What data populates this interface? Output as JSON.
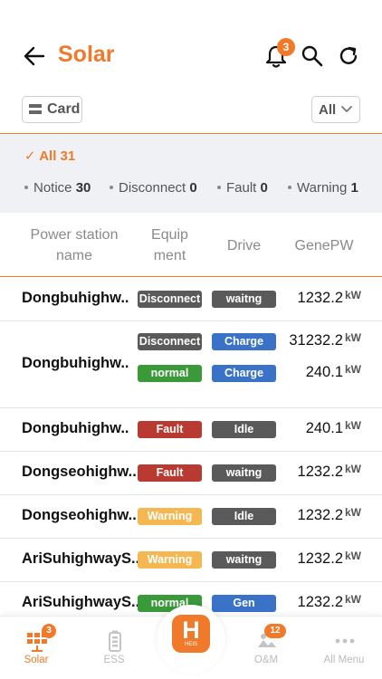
{
  "header": {
    "title": "Solar",
    "notification_count": "3"
  },
  "controls": {
    "view_label": "Card",
    "filter_label": "All"
  },
  "summary": {
    "all_label": "All",
    "all_count": "31",
    "stats": [
      {
        "label": "Notice",
        "count": "30"
      },
      {
        "label": "Disconnect",
        "count": "0"
      },
      {
        "label": "Fault",
        "count": "0"
      },
      {
        "label": "Warning",
        "count": "1"
      }
    ]
  },
  "table": {
    "columns": [
      "Power station\nname",
      "Equip\nment",
      "Drive",
      "GenePW"
    ],
    "unit": "kW",
    "rows": [
      {
        "name": "Dongbuhighw..",
        "entries": [
          {
            "equipment": "Disconnect",
            "drive": "waitng",
            "power": "1232.2"
          }
        ]
      },
      {
        "name": "Dongbuhighw..",
        "entries": [
          {
            "equipment": "Disconnect",
            "drive": "Charge",
            "power": "31232.2"
          },
          {
            "equipment": "normal",
            "drive": "Charge",
            "power": "240.1"
          }
        ]
      },
      {
        "name": "Dongbuhighw..",
        "entries": [
          {
            "equipment": "Fault",
            "drive": "Idle",
            "power": "240.1"
          }
        ]
      },
      {
        "name": "Dongseohighw..",
        "entries": [
          {
            "equipment": "Fault",
            "drive": "waitng",
            "power": "1232.2"
          }
        ]
      },
      {
        "name": "Dongseohighw..",
        "entries": [
          {
            "equipment": "Warning",
            "drive": "Idle",
            "power": "1232.2"
          }
        ]
      },
      {
        "name": "AriSuhighwayS..",
        "entries": [
          {
            "equipment": "Warning",
            "drive": "waitng",
            "power": "1232.2"
          }
        ]
      },
      {
        "name": "AriSuhighwayS..",
        "entries": [
          {
            "equipment": "normal",
            "drive": "Gen",
            "power": "1232.2"
          }
        ]
      }
    ]
  },
  "status_colors": {
    "Disconnect": "#5a5a5a",
    "normal": "#3a9a3a",
    "Fault": "#b83a30",
    "Warning": "#f4b752",
    "waitng": "#5a5a5a",
    "Idle": "#5a5a5a",
    "Charge": "#3a72c8",
    "Gen": "#3a72c8"
  },
  "accent_color": "#f07a2a",
  "bottom_nav": {
    "items": [
      {
        "label": "Solar",
        "icon": "solar-panel-icon",
        "badge": "3",
        "active": true
      },
      {
        "label": "ESS",
        "icon": "battery-icon",
        "badge": "",
        "active": false
      },
      {
        "label": "O&M",
        "icon": "maintenance-icon",
        "badge": "12",
        "active": false
      },
      {
        "label": "All Menu",
        "icon": "more-dots-icon",
        "badge": "",
        "active": false
      }
    ],
    "home": {
      "letter": "H",
      "sub": "HEIS"
    }
  }
}
